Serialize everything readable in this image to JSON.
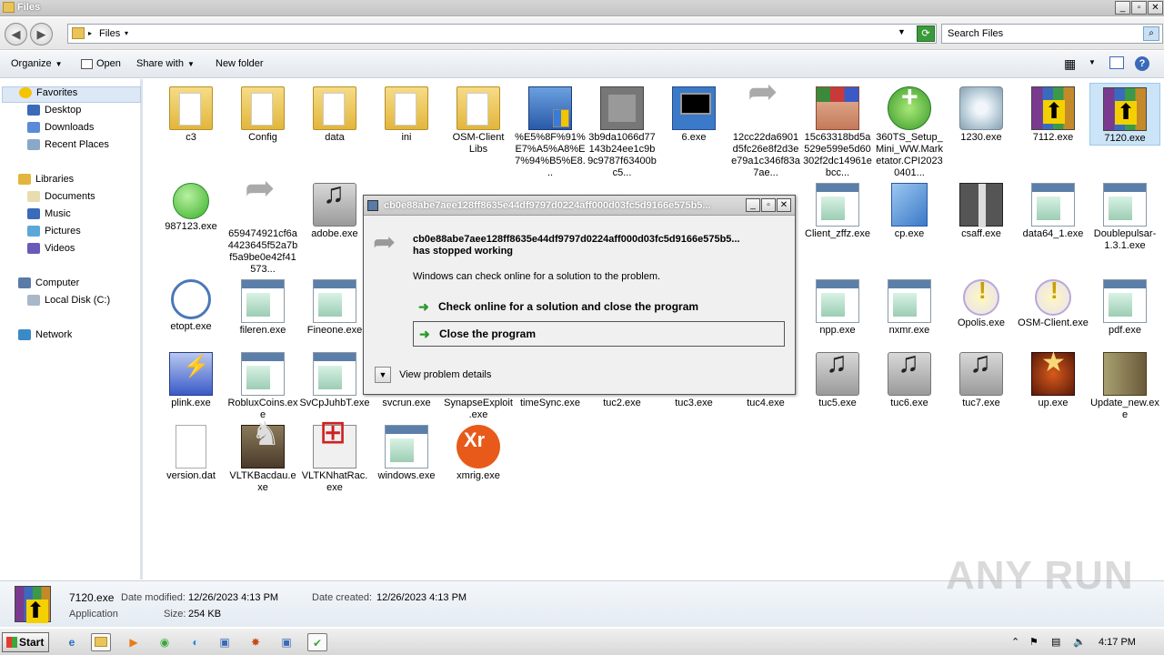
{
  "window": {
    "title": "Files"
  },
  "address": {
    "breadcrumb": "Files",
    "search_placeholder": "Search Files"
  },
  "toolbar": {
    "organize": "Organize",
    "open": "Open",
    "share_with": "Share with",
    "new_folder": "New folder"
  },
  "nav": {
    "favorites": "Favorites",
    "desktop": "Desktop",
    "downloads": "Downloads",
    "recent_places": "Recent Places",
    "libraries": "Libraries",
    "documents": "Documents",
    "music": "Music",
    "pictures": "Pictures",
    "videos": "Videos",
    "computer": "Computer",
    "local_disk": "Local Disk (C:)",
    "network": "Network"
  },
  "files": {
    "c3": "c3",
    "config": "Config",
    "data": "data",
    "ini": "ini",
    "osm_client_libs": "OSM-Client Libs",
    "urlencoded": "%E5%8F%91%E7%A5%A8%E7%94%B5%E8...",
    "hash_3b9d": "3b9da1066d77143b24ee1c9b9c9787f63400bc5...",
    "six": "6.exe",
    "hash_12cc": "12cc22da6901d5fc26e8f2d3ee79a1c346f83a7ae...",
    "hash_15c6": "15c63318bd5a529e599e5d60302f2dc14961ebcc...",
    "setup360": "360TS_Setup_Mini_WW.Marketator.CPI20230401...",
    "f1230": "1230.exe",
    "f7112": "7112.exe",
    "f7120": "7120.exe",
    "f987123": "987123.exe",
    "hash_6594": "659474921cf6a4423645f52a7bf5a9be0e42f41573...",
    "adobe": "adobe.exe",
    "client_zffz": "Client_zffz.exe",
    "cp": "cp.exe",
    "csaff": "csaff.exe",
    "data64": "data64_1.exe",
    "doublepulsar": "Doublepulsar-1.3.1.exe",
    "etopt": "etopt.exe",
    "fileren": "fileren.exe",
    "fineone": "Fineone.exe",
    "npp": "npp.exe",
    "nxmr": "nxmr.exe",
    "opolis": "Opolis.exe",
    "osm_client": "OSM-Client.exe",
    "pdf": "pdf.exe",
    "plink": "plink.exe",
    "robluxcoins": "RobluxCoins.exe",
    "svcpjuhbt": "SvCpJuhbT.exe",
    "svcrun": "svcrun.exe",
    "synapse": "SynapseExploit.exe",
    "timesync": "timeSync.exe",
    "tuc2": "tuc2.exe",
    "tuc3": "tuc3.exe",
    "tuc4": "tuc4.exe",
    "tuc5": "tuc5.exe",
    "tuc6": "tuc6.exe",
    "tuc7": "tuc7.exe",
    "up": "up.exe",
    "update_new": "Update_new.exe",
    "version": "version.dat",
    "vltkbacdau": "VLTKBacdau.exe",
    "vltknhatrac": "VLTKNhatRac.exe",
    "windows": "windows.exe",
    "xmrig": "xmrig.exe"
  },
  "dialog": {
    "title": "cb0e88abe7aee128ff8635e44df9797d0224aff000d03fc5d9166e575b5...",
    "message_line1": "cb0e88abe7aee128ff8635e44df9797d0224aff000d03fc5d9166e575b5...",
    "message_line2": "has stopped working",
    "sub": "Windows can check online for a solution to the problem.",
    "option_check": "Check online for a solution and close the program",
    "option_close": "Close the program",
    "details": "View problem details"
  },
  "details_pane": {
    "name": "7120.exe",
    "modified_label": "Date modified:",
    "modified_value": "12/26/2023 4:13 PM",
    "created_label": "Date created:",
    "created_value": "12/26/2023 4:13 PM",
    "type": "Application",
    "size_label": "Size:",
    "size_value": "254 KB"
  },
  "watermark": "ANY RUN",
  "taskbar": {
    "start": "Start",
    "time": "4:17 PM"
  }
}
